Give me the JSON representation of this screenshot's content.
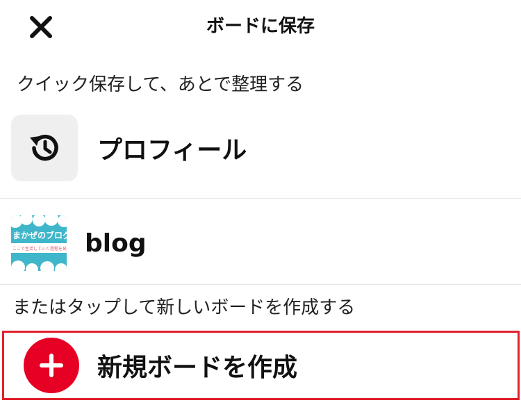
{
  "header": {
    "title": "ボードに保存"
  },
  "quick_save": {
    "label": "クイック保存して、あとで整理する"
  },
  "profile_row": {
    "label": "プロフィール"
  },
  "blog_row": {
    "label": "blog",
    "thumb_text": "まかぜのブログ",
    "thumb_subtext": "ここで生活していく過程を発信"
  },
  "create_section": {
    "label": "またはタップして新しいボードを作成する"
  },
  "create_row": {
    "label": "新規ボードを作成"
  },
  "colors": {
    "accent": "#e60023",
    "highlight_border": "#e1202d"
  }
}
